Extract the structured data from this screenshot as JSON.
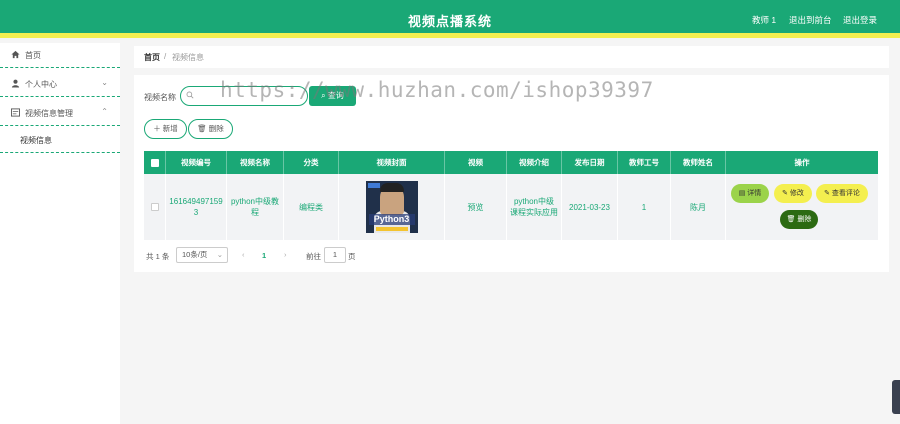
{
  "header": {
    "title": "视频点播系统",
    "user": "教师 1",
    "to_backend": "退出到前台",
    "logout": "退出登录"
  },
  "sidebar": {
    "items": [
      {
        "label": "首页",
        "icon": "home-icon"
      },
      {
        "label": "个人中心",
        "icon": "user-icon"
      },
      {
        "label": "视频信息管理",
        "icon": "list-icon"
      }
    ],
    "sub_items": [
      {
        "label": "视频信息"
      }
    ]
  },
  "breadcrumb": {
    "home": "首页",
    "separator": "/",
    "current": "视频信息"
  },
  "search": {
    "label": "视频名称",
    "placeholder": "",
    "button": "查询"
  },
  "actions": {
    "add": "新增",
    "delete": "删除"
  },
  "table": {
    "columns": [
      "视频编号",
      "视频名称",
      "分类",
      "视频封面",
      "视频",
      "视频介绍",
      "发布日期",
      "教师工号",
      "教师姓名",
      "操作"
    ],
    "rows": [
      {
        "code": "1616494971593",
        "name": "python中级教程",
        "category": "编程类",
        "cover_text": "Python3",
        "video": "预览",
        "intro": "python中级课程实际应用",
        "date": "2021-03-23",
        "teacher_no": "1",
        "teacher_name": "陈月",
        "ops": {
          "detail": "详情",
          "edit": "修改",
          "comments": "查看评论",
          "delete": "删除"
        }
      }
    ]
  },
  "pagination": {
    "total": "共 1 条",
    "page_size": "10条/页",
    "current_page": "1",
    "goto_label": "前往",
    "goto_value": "1",
    "page_suffix": "页"
  },
  "watermark": "https://www.huzhan.com/ishop39397",
  "colors": {
    "primary": "#1aa876",
    "accent_yellow": "#f4ef4f",
    "light_green": "#9bd34a",
    "dark_green": "#2c6a12"
  }
}
